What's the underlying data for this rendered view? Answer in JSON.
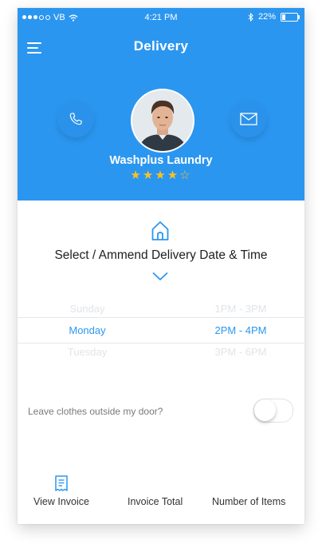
{
  "status_bar": {
    "carrier": "VB",
    "time": "4:21 PM",
    "battery": "22%"
  },
  "header": {
    "title": "Delivery",
    "name": "Washplus Laundry",
    "rating": 4,
    "rating_max": 5
  },
  "section": {
    "title": "Select / Ammend Delivery Date & Time"
  },
  "picker": {
    "rows": [
      {
        "day": "Sunday",
        "time": "1PM  -  3PM"
      },
      {
        "day": "Monday",
        "time": "2PM  -  4PM"
      },
      {
        "day": "Tuesday",
        "time": "3PM  -  6PM"
      }
    ]
  },
  "option": {
    "label": "Leave clothes outside my door?",
    "enabled": false
  },
  "footer": {
    "view_invoice": "View Invoice",
    "invoice_total": "Invoice Total",
    "number_of_items": "Number of Items"
  },
  "colors": {
    "accent": "#2b96f0",
    "star": "#f6c322"
  },
  "icons": [
    "menu-icon",
    "phone-icon",
    "mail-icon",
    "home-icon",
    "chevron-down-icon",
    "invoice-icon"
  ]
}
